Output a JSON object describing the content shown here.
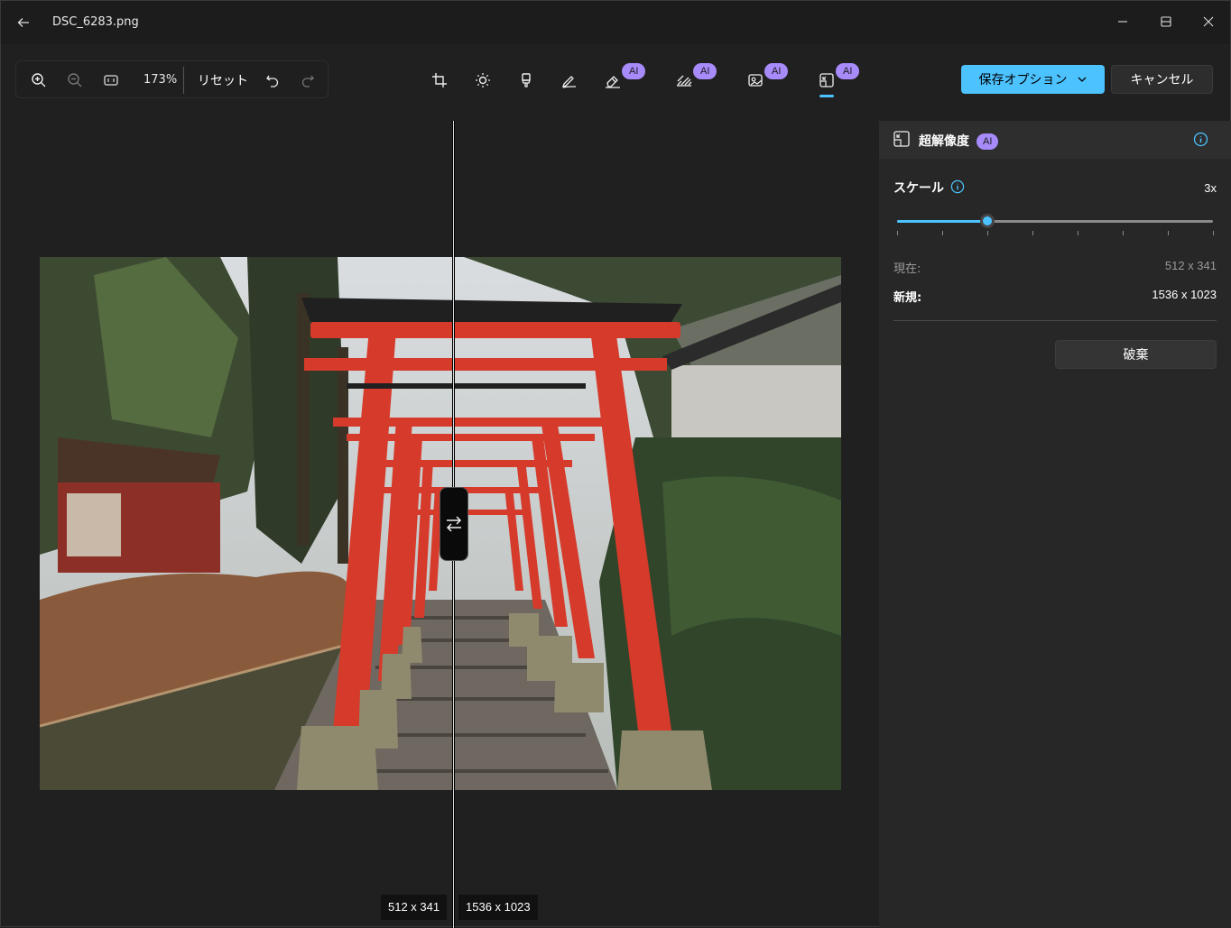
{
  "window": {
    "title": "DSC_6283.png"
  },
  "toolbar": {
    "zoom_level": "173%",
    "reset_label": "リセット",
    "ai_badge": "AI",
    "save_label": "保存オプション",
    "cancel_label": "キャンセル",
    "tools": [
      "crop-icon",
      "brightness-icon",
      "filter-icon",
      "markup-icon",
      "erase-icon",
      "background-icon",
      "restyle-icon",
      "super-resolution-icon"
    ]
  },
  "canvas": {
    "original_resolution": "512 x 341",
    "upscaled_resolution": "1536 x 1023"
  },
  "panel": {
    "title": "超解像度",
    "badge": "AI",
    "scale_label": "スケール",
    "scale_value": "3x",
    "slider_level": 0.286,
    "current_label": "現在:",
    "current_value": "512 x 341",
    "new_label": "新規:",
    "new_value": "1536 x 1023",
    "discard_label": "破棄"
  },
  "colors": {
    "accent": "#4cc2ff",
    "ai_badge": "#a78bfa",
    "background": "#202020",
    "panel": "#272727"
  }
}
